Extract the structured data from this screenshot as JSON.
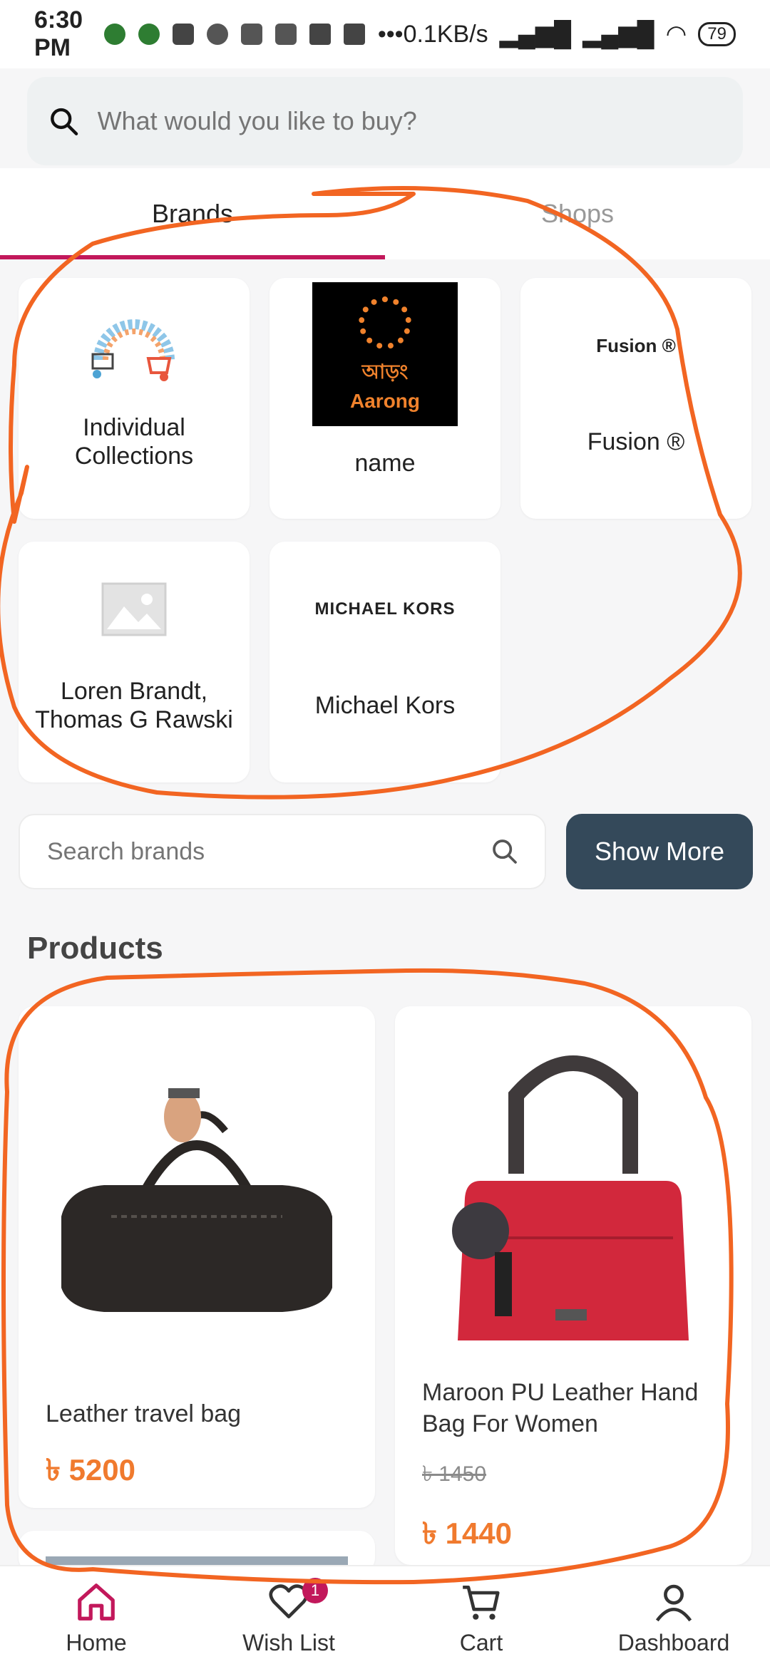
{
  "status_bar": {
    "time": "6:30 PM",
    "speed": "0.1KB/s",
    "battery": "79"
  },
  "search": {
    "placeholder": "What would you like to buy?"
  },
  "tabs": [
    {
      "label": "Brands"
    },
    {
      "label": "Shops"
    }
  ],
  "brands": [
    {
      "label": "Individual Collections"
    },
    {
      "label": "name",
      "logo_text_1": "আড়ং",
      "logo_text_2": "Aarong"
    },
    {
      "label": "Fusion ®",
      "logo_text": "Fusion ®"
    },
    {
      "label": "Loren Brandt, Thomas G Rawski"
    },
    {
      "label": "Michael Kors",
      "logo_text": "MICHAEL KORS"
    }
  ],
  "brand_search": {
    "placeholder": "Search brands"
  },
  "show_more": "Show More",
  "products_section": {
    "title": "Products"
  },
  "products": [
    {
      "name": "Leather travel bag",
      "price": "৳ 5200"
    },
    {
      "name": "Maroon PU Leather Hand Bag For Women",
      "old_price": "৳ 1450",
      "price": "৳ 1440"
    }
  ],
  "bottom_nav": [
    {
      "label": "Home"
    },
    {
      "label": "Wish List",
      "badge": "1"
    },
    {
      "label": "Cart"
    },
    {
      "label": "Dashboard"
    }
  ],
  "colors": {
    "accent": "#c2185b",
    "price": "#f07a2e",
    "button": "#34495a",
    "annotation": "#f26522"
  }
}
